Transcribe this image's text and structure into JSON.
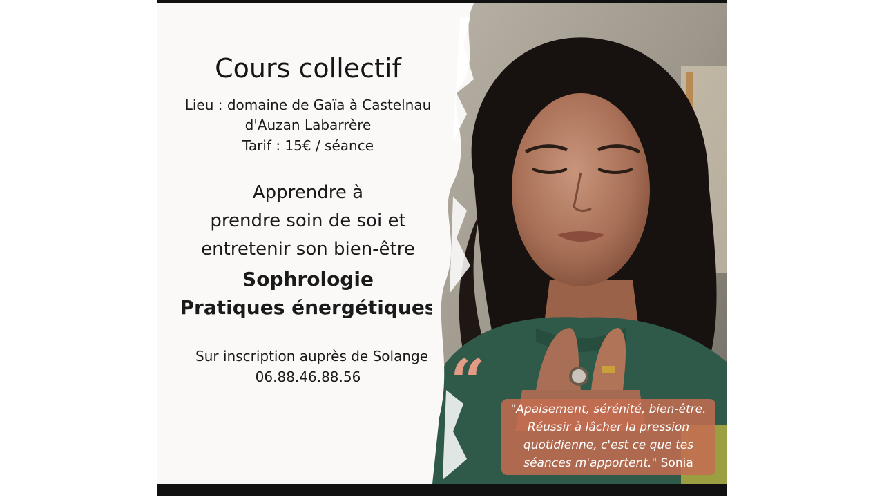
{
  "poster": {
    "title": "Cours collectif",
    "lieu_line1": "Lieu : domaine de Gaïa à Castelnau",
    "lieu_line2": "d'Auzan Labarrère",
    "tarif": "Tarif : 15€ / séance",
    "tagline_line1": "Apprendre à",
    "tagline_line2": "prendre soin de soi et",
    "tagline_line3": "entretenir son bien-être",
    "discipline1": "Sophrologie",
    "discipline2": "Pratiques énergétiques",
    "inscription": "Sur inscription  auprès de Solange",
    "phone": "06.88.46.88.56"
  },
  "testimonial": {
    "line1": "\"Apaisement, sérénité, bien-être.",
    "line2": "Réussir à lâcher la pression",
    "line3": "quotidienne, c'est ce que tes",
    "line4": "séances m'apportent.\"",
    "author": "Sonia"
  },
  "colors": {
    "quote_accent": "#e29c86",
    "quote_box": "#c46c50",
    "sweater": "#2f5a4a"
  },
  "photo": {
    "subject": "woman with eyes closed, hands crossed on chest"
  }
}
